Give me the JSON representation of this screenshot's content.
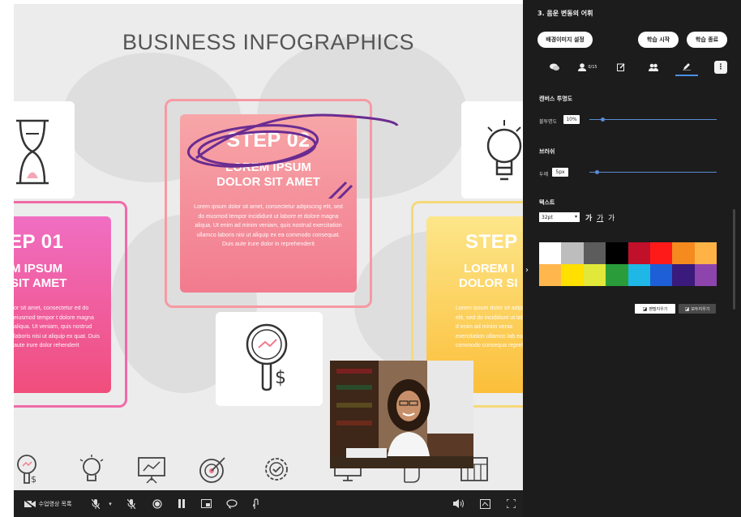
{
  "slide": {
    "title": "BUSINESS INFOGRAPHICS",
    "cards": [
      {
        "step": "EP 01",
        "lorem_line1": "M IPSUM",
        "lorem_line2": "SIT AMET",
        "body": "or sit amet, consectetur ed do eiusmod tempor t dolore magna aliqua. Ut veniam, quis nostrud laboris nisi ut aliquip ex quat. Duis aute irure dolor rehenderit"
      },
      {
        "step": "STEP 02",
        "lorem_line1": "LOREM IPSUM",
        "lorem_line2": "DOLOR SIT AMET",
        "body": "Lorem ipsum dolor sit amet, consectetur adipiscing elit, sed do eiusmod tempor incididunt ut labore et dolore magna aliqua. Ut enim ad minim veniam, quis nostrud exercitation ullamco laboris nisi ut aliquip ex ea commodo consequat. Duis aute irure dolor in reprehenderit"
      },
      {
        "step": "STEP",
        "lorem_line1": "LOREM I",
        "lorem_line2": "DOLOR SI",
        "body": "Lorem ipsum dolor sit adipiscing elit, sed do incididunt ut labore et d enim ad minim venia exercitation ullamco lab ea commodo consequa reprehe"
      }
    ],
    "icons": [
      "search-dollar-icon",
      "lightbulb-icon",
      "presentation-chart-icon",
      "target-icon",
      "gear-check-icon",
      "monitor-icon",
      "hand-icon",
      "calendar-icon"
    ]
  },
  "toolbar": {
    "video_list_label": "수업영상 목록"
  },
  "panel": {
    "title": "3. 음운 변동의 어휘",
    "bg_button": "배경이미지 설정",
    "start_button": "학습 시작",
    "end_button": "학습 종료",
    "participants_count": "0/15",
    "canvas_section": "캔버스 투명도",
    "opacity_label": "불투명도",
    "opacity_value": "10%",
    "opacity_level": 0.1,
    "brush_section": "브러쉬",
    "thickness_label": "두께",
    "thickness_value": "5px",
    "thickness_level": 0.06,
    "text_section": "텍스트",
    "font_size": "32pt",
    "style_bold": "가",
    "style_underline": "가",
    "style_normal": "가",
    "colors": [
      "#ffffff",
      "#bdbdbd",
      "#5c5c5c",
      "#000000",
      "#c0102a",
      "#ff1a1a",
      "#f58a1f",
      "#ffb347",
      "#ffb74d",
      "#ffe000",
      "#e2e83a",
      "#2a9d3a",
      "#1fb8e6",
      "#1e5fd8",
      "#3a1a7a",
      "#8e44ad"
    ],
    "eraser_button": "펜텔지우기",
    "clear_all_button": "모두지우기"
  }
}
